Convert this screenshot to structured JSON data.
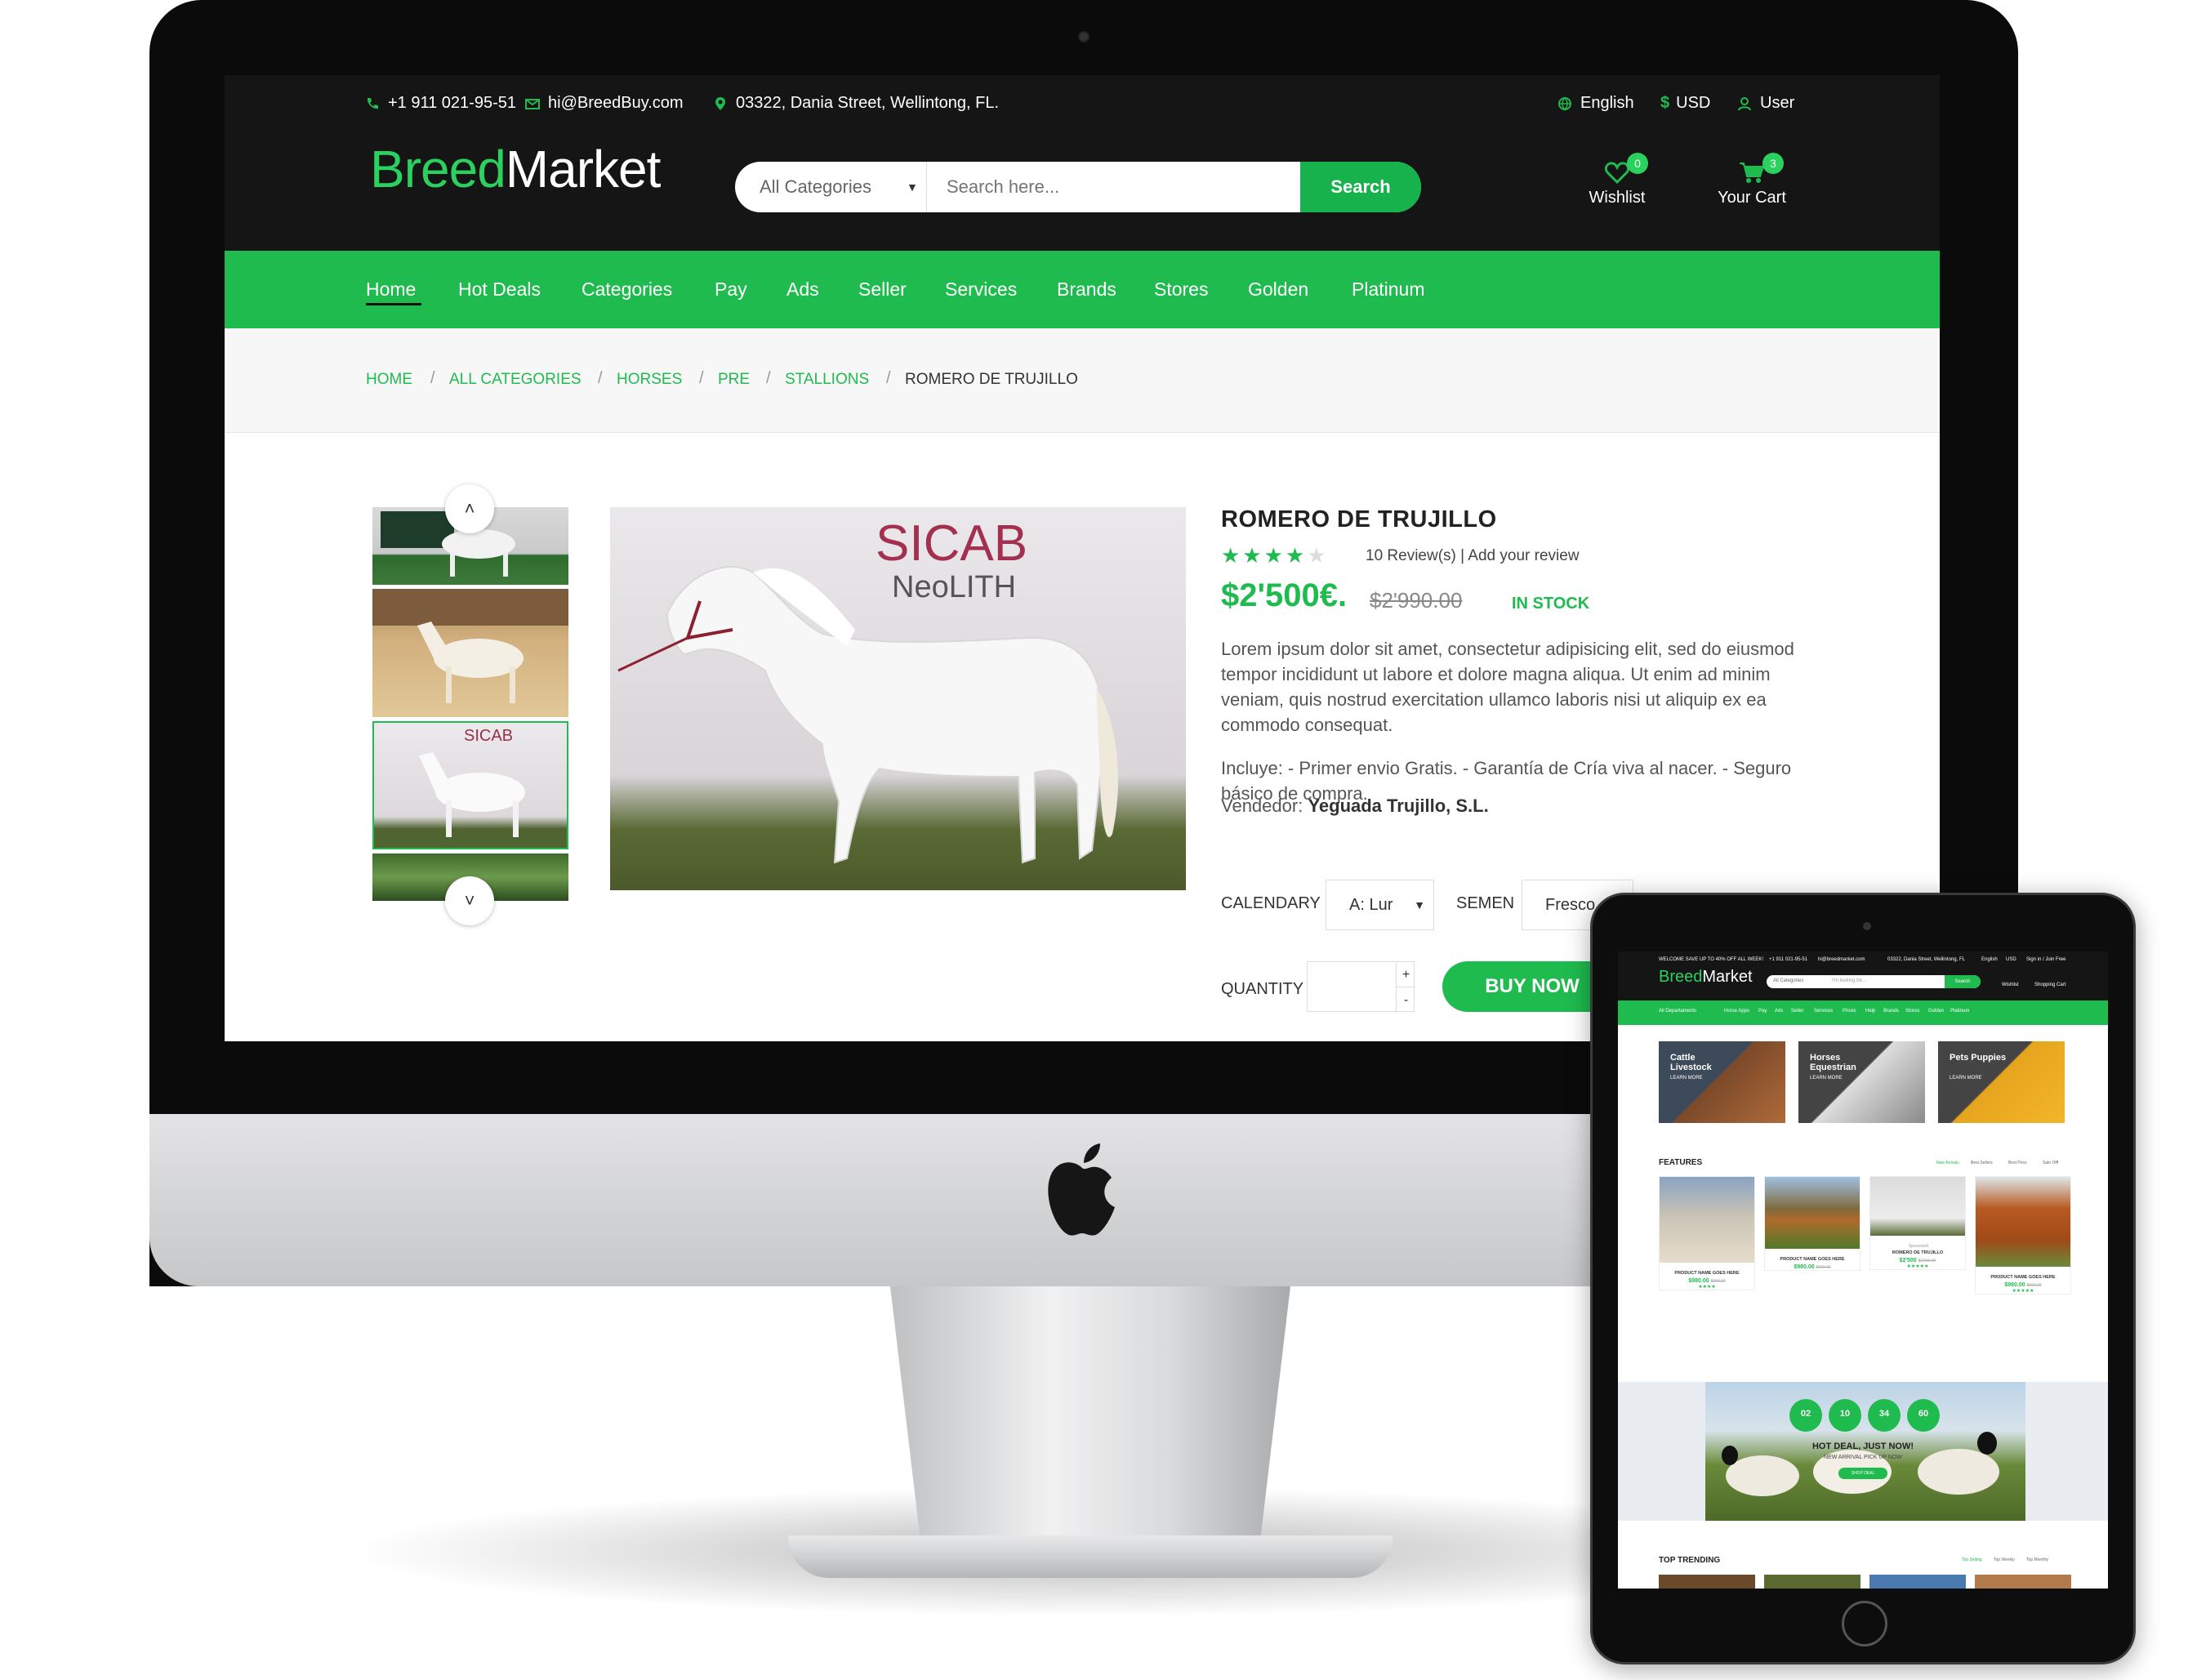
{
  "desktop": {
    "topbar": {
      "phone": "+1 911 021-95-51",
      "email": "hi@BreedBuy.com",
      "address": "03322, Dania Street, Wellintong, FL.",
      "language": "English",
      "currency": "USD",
      "user": "User"
    },
    "header": {
      "logo_part1": "Breed",
      "logo_part2": "Market",
      "search_category": "All Categories",
      "search_placeholder": "Search here...",
      "search_button": "Search",
      "wishlist_label": "Wishlist",
      "wishlist_count": "0",
      "cart_label": "Your Cart",
      "cart_count": "3"
    },
    "nav": {
      "items": [
        "Home",
        "Hot Deals",
        "Categories",
        "Pay",
        "Ads",
        "Seller",
        "Services",
        "Brands",
        "Stores",
        "Golden",
        "Platinum"
      ]
    },
    "breadcrumb": [
      "HOME",
      "ALL CATEGORIES",
      "HORSES",
      "PRE",
      "STALLIONS",
      "ROMERO DE TRUJILLO"
    ],
    "product": {
      "title": "ROMERO DE TRUJILLO",
      "rating": 4,
      "rating_max": 5,
      "stars": "★★★★",
      "stars_empty": "★",
      "reviews": "10 Review(s) | Add your review",
      "price": "$2'500€.",
      "old_price": "$2'990.00",
      "stock": "IN STOCK",
      "description": "Lorem ipsum dolor sit amet, consectetur adipisicing elit, sed do eiusmod tempor incididunt ut labore et dolore magna aliqua. Ut enim ad minim veniam, quis nostrud exercitation ullamco laboris nisi ut aliquip ex ea commodo consequat.",
      "includes": "Incluye: - Primer envio Gratis. - Garantía de Cría viva al nacer. - Seguro básico de compra.",
      "seller_label": "Vendedor:",
      "seller_name": "Yeguada Trujillo, S.L.",
      "image_brand_1": "SICAB",
      "image_brand_2": "NeoLITH",
      "calendar_label": "CALENDARY",
      "calendar_value": "A: Lur",
      "semen_label": "SEMEN",
      "semen_value": "Fresco",
      "quantity_label": "QUANTITY",
      "qty_plus": "+",
      "qty_minus": "-",
      "buy_now": "BUY NOW"
    },
    "colors": {
      "accent": "#1fbb4f",
      "topbar": "#151515"
    }
  },
  "tablet": {
    "topbar_left": "WELCOME SAVE UP TO 40% OFF ALL WEEK!",
    "topbar_phone": "+1 911 021-95-51",
    "topbar_email": "hi@breedmarket.com",
    "topbar_address": "03322, Dania Street, Wellintong, FL",
    "topbar_lang": "English",
    "topbar_currency": "USD",
    "topbar_user": "Sign in / Join Free",
    "logo_part1": "Breed",
    "logo_part2": "Market",
    "search_category": "All Categories",
    "search_placeholder": "I'm looking for...",
    "search_button": "Search",
    "wishlist": "Wishlist",
    "cart": "Shopping Cart",
    "nav": [
      "All Departaments",
      "Horse Apps",
      "Pay",
      "Ads",
      "Seller",
      "Services",
      "Prices",
      "Help",
      "Brands",
      "Stores",
      "Golden",
      "Platinum"
    ],
    "categories": [
      {
        "title": "Cattle Livestock",
        "cta": "LEARN MORE"
      },
      {
        "title": "Horses Equestrian",
        "cta": "LEARN MORE"
      },
      {
        "title": "Pets Puppies",
        "cta": "LEARN MORE"
      }
    ],
    "features_title": "FEATURES",
    "features_tabs": [
      "New Arrivals",
      "Best Sellers",
      "Best Price",
      "Sale Offf"
    ],
    "products": [
      {
        "name": "PRODUCT NAME GOES HERE",
        "price": "$980.00",
        "old": "$990.00"
      },
      {
        "name": "PRODUCT NAME GOES HERE",
        "price": "$980.00",
        "old": "$990.00"
      },
      {
        "name": "ROMERO DE TRUJILLO",
        "price": "$2'500",
        "old": "$2'990.00",
        "tag": "Sponsored"
      },
      {
        "name": "PRODUCT NAME GOES HERE",
        "price": "$980.00",
        "old": "$990.00"
      }
    ],
    "timer": [
      "02",
      "10",
      "34",
      "60"
    ],
    "hot_deal_title": "HOT DEAL, JUST NOW!",
    "hot_deal_sub": "NEW ARRIVAL PICK UP NOW",
    "hot_deal_button": "SHOP DEAL",
    "trending_title": "TOP TRENDING",
    "trending_tabs": [
      "Top Selling",
      "Top Weekly",
      "Top Monthly"
    ]
  }
}
